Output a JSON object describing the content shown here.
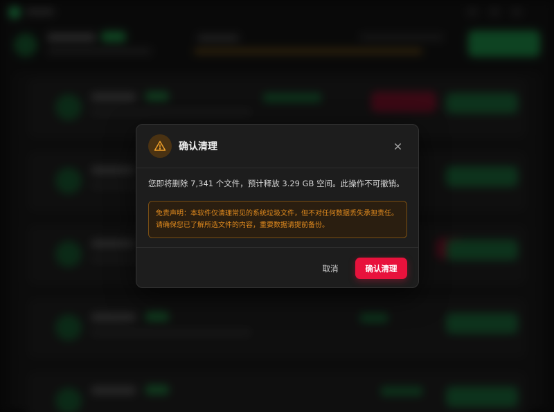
{
  "dialog": {
    "title": "确认清理",
    "message": "您即将删除 7,341 个文件，预计释放 3.29 GB 空间。此操作不可撤销。",
    "disclaimer": "免责声明：本软件仅清理常见的系统垃圾文件，但不对任何数据丢失承担责任。请确保您已了解所选文件的内容，重要数据请提前备份。",
    "cancel_label": "取消",
    "confirm_label": "确认清理",
    "close_icon": "close-icon",
    "warning_icon": "warning-triangle-icon"
  },
  "colors": {
    "accent_green": "#1f8f4a",
    "danger": "#e8123c",
    "warning": "#e08a1e",
    "dialog_bg": "#1d1d1d"
  }
}
